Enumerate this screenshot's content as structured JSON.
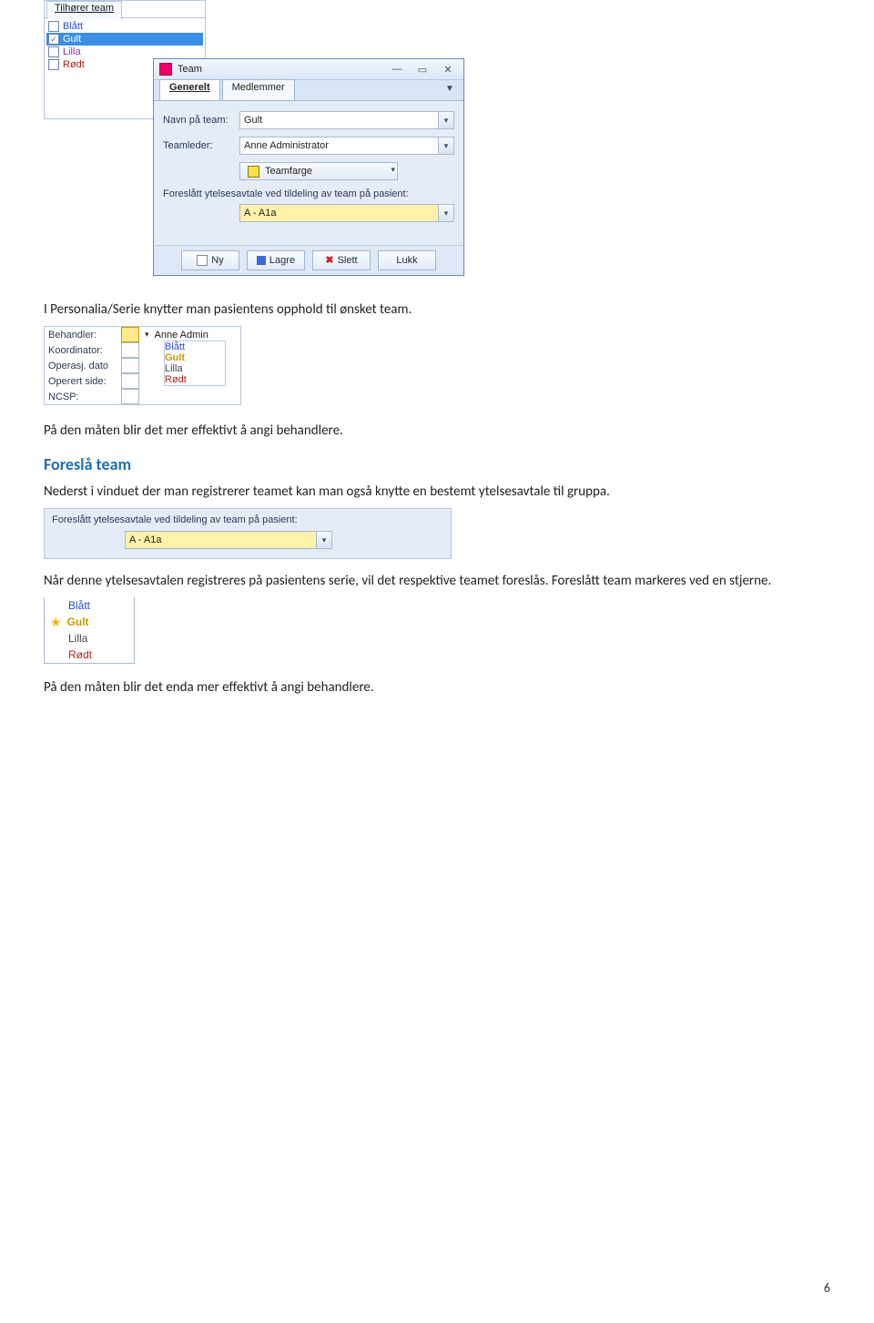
{
  "shot1": {
    "tab": "Tilhører team",
    "items": [
      {
        "label": "Blått",
        "checked": false,
        "cls": "bl"
      },
      {
        "label": "Gult",
        "checked": true,
        "cls": "gu",
        "selected": true
      },
      {
        "label": "Lilla",
        "checked": false,
        "cls": "li"
      },
      {
        "label": "Rødt",
        "checked": false,
        "cls": "ro"
      }
    ]
  },
  "teamwin": {
    "title": "Team",
    "tabs": {
      "generelt": "Generelt",
      "medlemmer": "Medlemmer"
    },
    "fields": {
      "navn_label": "Navn på team:",
      "navn_value": "Gult",
      "leder_label": "Teamleder:",
      "leder_value": "Anne Administrator",
      "teamfarge": "Teamfarge",
      "foreslatt_label": "Foreslått ytelsesavtale ved tildeling av team på pasient:",
      "foreslatt_value": "A - A1a"
    },
    "buttons": {
      "ny": "Ny",
      "lagre": "Lagre",
      "slett": "Slett",
      "lukk": "Lukk"
    }
  },
  "para1": "I Personalia/Serie knytter man pasientens opphold til ønsket team.",
  "shot2": {
    "rows": [
      {
        "label": "Behandler:",
        "value": "Anne Admin"
      },
      {
        "label": "Koordinator:",
        "value": ""
      },
      {
        "label": "Operasj. dato",
        "value": ""
      },
      {
        "label": "Operert side:",
        "value": ""
      },
      {
        "label": "NCSP:",
        "value": ""
      }
    ],
    "dropdown": [
      "Blått",
      "Gult",
      "Lilla",
      "Rødt"
    ]
  },
  "para2": "På den måten blir det mer effektivt å angi behandlere.",
  "h_foresla": "Foreslå team",
  "para3": "Nederst i vinduet der man registrerer teamet kan man også knytte en bestemt ytelsesavtale til gruppa.",
  "shot3": {
    "caption": "Foreslått ytelsesavtale ved tildeling av team på pasient:",
    "value": "A - A1a"
  },
  "para4_a": "Når denne ytelsesavtalen registreres på pasientens serie, vil det respektive teamet foreslås. Foreslått team markeres ved en stjerne.",
  "shot4": {
    "items": [
      {
        "label": "Blått",
        "cls": "c-bl",
        "star": false
      },
      {
        "label": "Gult",
        "cls": "c-gu",
        "star": true
      },
      {
        "label": "Lilla",
        "cls": "c-li",
        "star": false
      },
      {
        "label": "Rødt",
        "cls": "c-ro",
        "star": false
      }
    ]
  },
  "para5": "På den måten blir det enda mer effektivt å angi behandlere.",
  "pagenum": "6"
}
